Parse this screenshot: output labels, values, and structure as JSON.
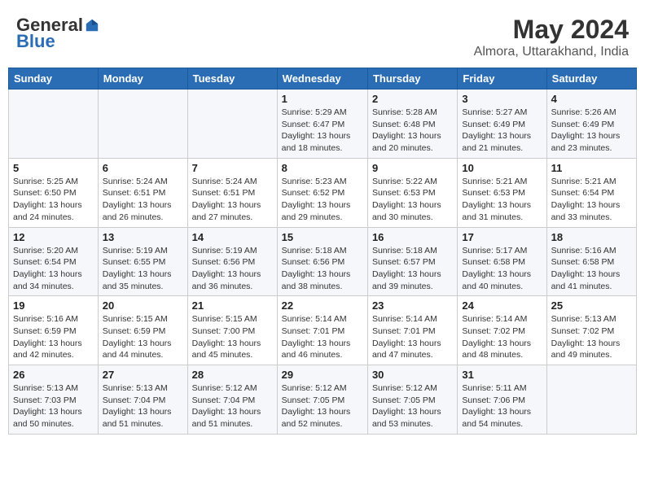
{
  "header": {
    "logo_general": "General",
    "logo_blue": "Blue",
    "month": "May 2024",
    "location": "Almora, Uttarakhand, India"
  },
  "weekdays": [
    "Sunday",
    "Monday",
    "Tuesday",
    "Wednesday",
    "Thursday",
    "Friday",
    "Saturday"
  ],
  "weeks": [
    [
      {
        "day": "",
        "info": ""
      },
      {
        "day": "",
        "info": ""
      },
      {
        "day": "",
        "info": ""
      },
      {
        "day": "1",
        "info": "Sunrise: 5:29 AM\nSunset: 6:47 PM\nDaylight: 13 hours\nand 18 minutes."
      },
      {
        "day": "2",
        "info": "Sunrise: 5:28 AM\nSunset: 6:48 PM\nDaylight: 13 hours\nand 20 minutes."
      },
      {
        "day": "3",
        "info": "Sunrise: 5:27 AM\nSunset: 6:49 PM\nDaylight: 13 hours\nand 21 minutes."
      },
      {
        "day": "4",
        "info": "Sunrise: 5:26 AM\nSunset: 6:49 PM\nDaylight: 13 hours\nand 23 minutes."
      }
    ],
    [
      {
        "day": "5",
        "info": "Sunrise: 5:25 AM\nSunset: 6:50 PM\nDaylight: 13 hours\nand 24 minutes."
      },
      {
        "day": "6",
        "info": "Sunrise: 5:24 AM\nSunset: 6:51 PM\nDaylight: 13 hours\nand 26 minutes."
      },
      {
        "day": "7",
        "info": "Sunrise: 5:24 AM\nSunset: 6:51 PM\nDaylight: 13 hours\nand 27 minutes."
      },
      {
        "day": "8",
        "info": "Sunrise: 5:23 AM\nSunset: 6:52 PM\nDaylight: 13 hours\nand 29 minutes."
      },
      {
        "day": "9",
        "info": "Sunrise: 5:22 AM\nSunset: 6:53 PM\nDaylight: 13 hours\nand 30 minutes."
      },
      {
        "day": "10",
        "info": "Sunrise: 5:21 AM\nSunset: 6:53 PM\nDaylight: 13 hours\nand 31 minutes."
      },
      {
        "day": "11",
        "info": "Sunrise: 5:21 AM\nSunset: 6:54 PM\nDaylight: 13 hours\nand 33 minutes."
      }
    ],
    [
      {
        "day": "12",
        "info": "Sunrise: 5:20 AM\nSunset: 6:54 PM\nDaylight: 13 hours\nand 34 minutes."
      },
      {
        "day": "13",
        "info": "Sunrise: 5:19 AM\nSunset: 6:55 PM\nDaylight: 13 hours\nand 35 minutes."
      },
      {
        "day": "14",
        "info": "Sunrise: 5:19 AM\nSunset: 6:56 PM\nDaylight: 13 hours\nand 36 minutes."
      },
      {
        "day": "15",
        "info": "Sunrise: 5:18 AM\nSunset: 6:56 PM\nDaylight: 13 hours\nand 38 minutes."
      },
      {
        "day": "16",
        "info": "Sunrise: 5:18 AM\nSunset: 6:57 PM\nDaylight: 13 hours\nand 39 minutes."
      },
      {
        "day": "17",
        "info": "Sunrise: 5:17 AM\nSunset: 6:58 PM\nDaylight: 13 hours\nand 40 minutes."
      },
      {
        "day": "18",
        "info": "Sunrise: 5:16 AM\nSunset: 6:58 PM\nDaylight: 13 hours\nand 41 minutes."
      }
    ],
    [
      {
        "day": "19",
        "info": "Sunrise: 5:16 AM\nSunset: 6:59 PM\nDaylight: 13 hours\nand 42 minutes."
      },
      {
        "day": "20",
        "info": "Sunrise: 5:15 AM\nSunset: 6:59 PM\nDaylight: 13 hours\nand 44 minutes."
      },
      {
        "day": "21",
        "info": "Sunrise: 5:15 AM\nSunset: 7:00 PM\nDaylight: 13 hours\nand 45 minutes."
      },
      {
        "day": "22",
        "info": "Sunrise: 5:14 AM\nSunset: 7:01 PM\nDaylight: 13 hours\nand 46 minutes."
      },
      {
        "day": "23",
        "info": "Sunrise: 5:14 AM\nSunset: 7:01 PM\nDaylight: 13 hours\nand 47 minutes."
      },
      {
        "day": "24",
        "info": "Sunrise: 5:14 AM\nSunset: 7:02 PM\nDaylight: 13 hours\nand 48 minutes."
      },
      {
        "day": "25",
        "info": "Sunrise: 5:13 AM\nSunset: 7:02 PM\nDaylight: 13 hours\nand 49 minutes."
      }
    ],
    [
      {
        "day": "26",
        "info": "Sunrise: 5:13 AM\nSunset: 7:03 PM\nDaylight: 13 hours\nand 50 minutes."
      },
      {
        "day": "27",
        "info": "Sunrise: 5:13 AM\nSunset: 7:04 PM\nDaylight: 13 hours\nand 51 minutes."
      },
      {
        "day": "28",
        "info": "Sunrise: 5:12 AM\nSunset: 7:04 PM\nDaylight: 13 hours\nand 51 minutes."
      },
      {
        "day": "29",
        "info": "Sunrise: 5:12 AM\nSunset: 7:05 PM\nDaylight: 13 hours\nand 52 minutes."
      },
      {
        "day": "30",
        "info": "Sunrise: 5:12 AM\nSunset: 7:05 PM\nDaylight: 13 hours\nand 53 minutes."
      },
      {
        "day": "31",
        "info": "Sunrise: 5:11 AM\nSunset: 7:06 PM\nDaylight: 13 hours\nand 54 minutes."
      },
      {
        "day": "",
        "info": ""
      }
    ]
  ]
}
